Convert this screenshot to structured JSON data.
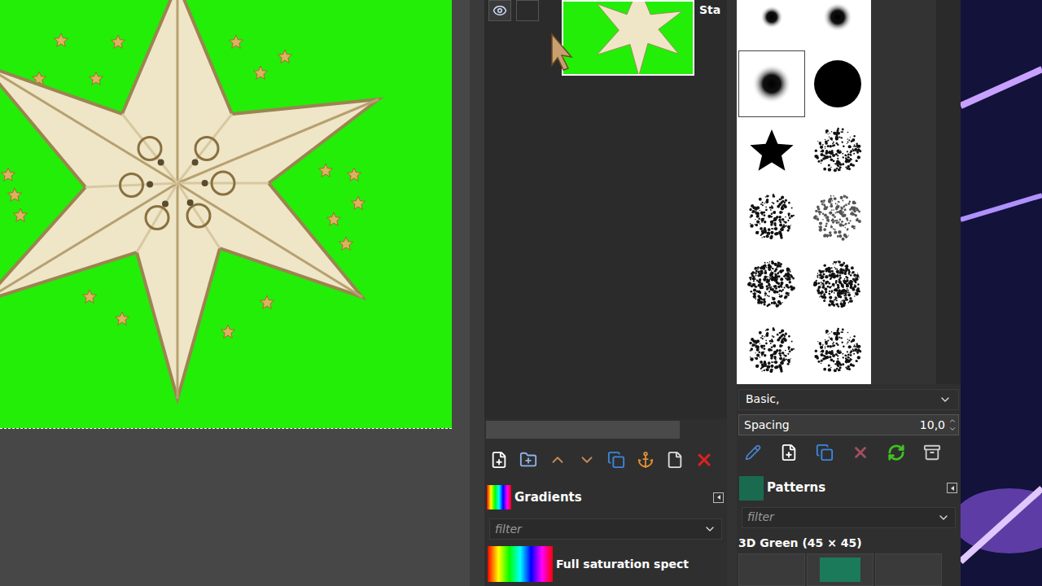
{
  "layers": [
    {
      "name": "Sta",
      "visible": true,
      "selected": true
    }
  ],
  "gradients": {
    "title": "Gradients",
    "filter_placeholder": "filter",
    "items": [
      {
        "name": "Full saturation spect"
      }
    ]
  },
  "brushes": {
    "items": [
      {
        "kind": "soft-small",
        "selected": false
      },
      {
        "kind": "soft-medium",
        "selected": false
      },
      {
        "kind": "soft-large",
        "selected": true
      },
      {
        "kind": "hard",
        "selected": false
      },
      {
        "kind": "star",
        "selected": false
      },
      {
        "kind": "texture-fine",
        "selected": false
      },
      {
        "kind": "texture-coarse",
        "selected": false
      },
      {
        "kind": "texture-streak",
        "selected": false
      },
      {
        "kind": "texture-dark",
        "selected": false
      },
      {
        "kind": "texture-tree",
        "selected": false
      },
      {
        "kind": "texture-coarse",
        "selected": false
      },
      {
        "kind": "texture-fine",
        "selected": false
      }
    ],
    "tag": "Basic,",
    "spacing": {
      "label": "Spacing",
      "value": "10,0"
    }
  },
  "patterns": {
    "title": "Patterns",
    "filter_placeholder": "filter",
    "selected_name": "3D Green (45 × 45)"
  }
}
